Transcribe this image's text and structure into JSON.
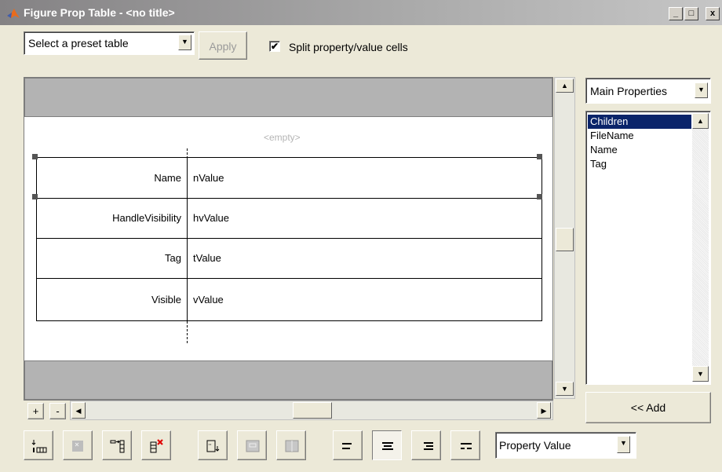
{
  "window": {
    "title": "Figure Prop Table - <no title>",
    "controls": [
      "_",
      "□",
      "x"
    ]
  },
  "toolbar_top": {
    "preset_select_value": "Select a preset table",
    "apply_label": "Apply",
    "split_checkbox_label": "Split property/value cells",
    "split_checked": true
  },
  "table": {
    "empty_label": "<empty>",
    "rows": [
      {
        "property": "Name",
        "value": "nValue"
      },
      {
        "property": "HandleVisibility",
        "value": "hvValue"
      },
      {
        "property": "Tag",
        "value": "tValue"
      },
      {
        "property": "Visible",
        "value": "vValue"
      }
    ]
  },
  "canvas_controls": {
    "plus_label": "+",
    "minus_label": "-"
  },
  "properties_panel": {
    "group_select_value": "Main Properties",
    "items": [
      "Children",
      "FileName",
      "Name",
      "Tag"
    ],
    "selected_index": 0,
    "add_button_label": "<< Add"
  },
  "bottom_toolbar": {
    "display_select_value": "Property Value",
    "alignment_pressed": "center"
  },
  "colors": {
    "title_bar": "#a0a0a0",
    "band": "#b3b3b3",
    "selection": "#0a246a",
    "delete_red": "#e00000"
  }
}
